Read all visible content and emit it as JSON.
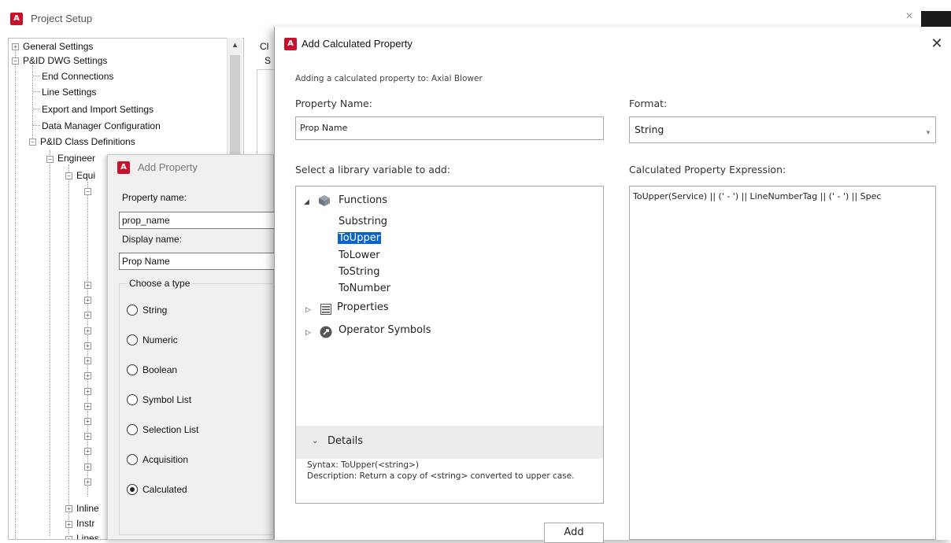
{
  "project_setup": {
    "title": "Project Setup",
    "logo_letter": "A",
    "close_glyph": "×",
    "tree": {
      "general_settings": "General Settings",
      "pid_dwg_settings": "P&ID DWG Settings",
      "end_connections": "End Connections",
      "line_settings": "Line Settings",
      "export_import": "Export and Import Settings",
      "data_manager": "Data Manager Configuration",
      "class_definitions": "P&ID Class Definitions",
      "engineering": "Engineer",
      "equipment": "Equi",
      "inline": "Inline",
      "instr": "Instr",
      "lines": "Lines"
    },
    "right_panel": {
      "label_top": "Cl",
      "label_second": "S"
    }
  },
  "add_property": {
    "title": "Add Property",
    "logo_letter": "A",
    "property_name_label": "Property name:",
    "property_name_value": "prop_name",
    "display_name_label": "Display name:",
    "display_name_value": "Prop Name",
    "type_group_label": "Choose a type",
    "types": [
      {
        "label": "String",
        "checked": false
      },
      {
        "label": "Numeric",
        "checked": false
      },
      {
        "label": "Boolean",
        "checked": false
      },
      {
        "label": "Symbol List",
        "checked": false
      },
      {
        "label": "Selection List",
        "checked": false
      },
      {
        "label": "Acquisition",
        "checked": false
      },
      {
        "label": "Calculated",
        "checked": true
      }
    ]
  },
  "add_calculated_property": {
    "title": "Add Calculated Property",
    "logo_letter": "A",
    "close_glyph": "✕",
    "subtitle": "Adding a calculated property to: Axial Blower",
    "property_name_label": "Property Name:",
    "property_name_value": "Prop Name",
    "format_label": "Format:",
    "format_value": "String",
    "library_label": "Select a library variable to add:",
    "library": {
      "functions": {
        "label": "Functions",
        "icon": "cube-icon",
        "children": [
          "Substring",
          "ToUpper",
          "ToLower",
          "ToString",
          "ToNumber"
        ],
        "selected": "ToUpper"
      },
      "properties": {
        "label": "Properties",
        "icon": "properties-icon"
      },
      "operators": {
        "label": "Operator Symbols",
        "icon": "operator-icon"
      }
    },
    "details": {
      "title": "Details",
      "syntax": "Syntax: ToUpper(<string>)",
      "description": "Description: Return a copy of <string> converted to upper case."
    },
    "expression_label": "Calculated Property Expression:",
    "expression_value": "ToUpper(Service) || (' - ') || LineNumberTag || (' - ') || Spec",
    "add_button_label": "Add"
  },
  "colors": {
    "accent": "#0a64c8",
    "logo_red": "#c8102e"
  }
}
